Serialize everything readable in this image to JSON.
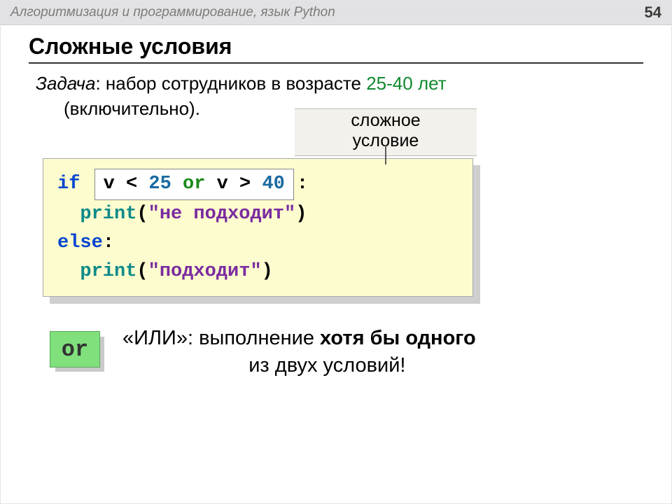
{
  "topbar": {
    "title": "Алгоритмизация и программирование, язык Python",
    "page": "54"
  },
  "heading": "Сложные условия",
  "task": {
    "label": "Задача",
    "sep": ": ",
    "p1": "набор сотрудников в возрасте ",
    "range": "25-40 лет",
    "p2": "(включительно).",
    "callout1": "сложное",
    "callout2": "условие"
  },
  "code": {
    "kw_if": "if",
    "cond_v1": "v",
    "cond_op1": " < ",
    "cond_n1": "25",
    "cond_or": " or ",
    "cond_v2": "v",
    "cond_op2": " > ",
    "cond_n2": "40",
    "colon": ":",
    "print": "print",
    "s1": "\"не подходит\"",
    "kw_else": "else",
    "s2": "\"подходит\""
  },
  "orblock": {
    "badge": "or",
    "t1a": "«ИЛИ»: выполнение ",
    "t1b": "хотя бы одного",
    "t2": "из двух условий!"
  }
}
